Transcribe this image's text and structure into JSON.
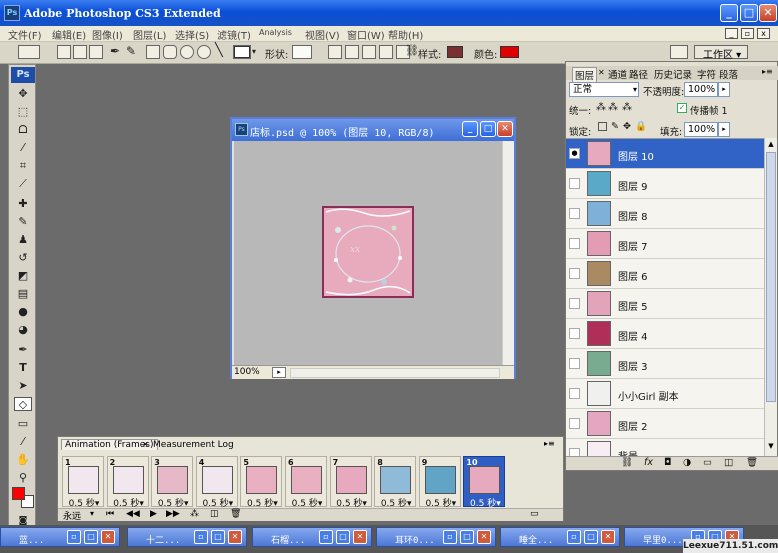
{
  "app": {
    "title": "Adobe Photoshop CS3 Extended"
  },
  "menu": [
    "文件(F)",
    "编辑(E)",
    "图像(I)",
    "图层(L)",
    "选择(S)",
    "滤镜(T)",
    "Analysis",
    "视图(V)",
    "窗口(W)",
    "帮助(H)"
  ],
  "options": {
    "shape_label": "形状:",
    "style_label": "样式:",
    "color_label": "颜色:",
    "color_value": "#e00000",
    "style_value": "#7a3030",
    "workspace": "工作区 ▾"
  },
  "toolbox": {
    "logo": "Ps",
    "fg_color": "#ff0000",
    "bg_color": "#ffffff"
  },
  "document": {
    "title": "店标.psd @ 100% (图层 10, RGB/8)",
    "zoom": "100%"
  },
  "layers_panel": {
    "tabs": [
      "图层",
      "通道",
      "路径",
      "历史记录",
      "字符",
      "段落"
    ],
    "blend_mode": "正常",
    "opacity_label": "不透明度:",
    "opacity": "100%",
    "unify_label": "统一:",
    "propagate_label": "传播帧 1",
    "lock_label": "锁定:",
    "fill_label": "填充:",
    "fill": "100%",
    "layers": [
      {
        "name": "图层 10",
        "selected": true
      },
      {
        "name": "图层 9"
      },
      {
        "name": "图层 8"
      },
      {
        "name": "图层 7"
      },
      {
        "name": "图层 6"
      },
      {
        "name": "图层 5"
      },
      {
        "name": "图层 4"
      },
      {
        "name": "图层 3"
      },
      {
        "name": "小小Girl 副本"
      },
      {
        "name": "图层 2"
      },
      {
        "name": "背景"
      }
    ]
  },
  "animation": {
    "tabs": [
      "Animation (Frames)",
      "Measurement Log"
    ],
    "frames": [
      {
        "n": "1",
        "delay": "0.5 秒▾"
      },
      {
        "n": "2",
        "delay": "0.5 秒▾"
      },
      {
        "n": "3",
        "delay": "0.5 秒▾"
      },
      {
        "n": "4",
        "delay": "0.5 秒▾"
      },
      {
        "n": "5",
        "delay": "0.5 秒▾"
      },
      {
        "n": "6",
        "delay": "0.5 秒▾"
      },
      {
        "n": "7",
        "delay": "0.5 秒▾"
      },
      {
        "n": "8",
        "delay": "0.5 秒▾"
      },
      {
        "n": "9",
        "delay": "0.5 秒▾"
      },
      {
        "n": "10",
        "delay": "0.5 秒▾"
      }
    ],
    "loop": "永远"
  },
  "minimized": [
    "蓝...",
    "十二...",
    "石榴...",
    "耳环0...",
    "睡全...",
    "早里0..."
  ],
  "watermark": "Leexue711.51.com"
}
